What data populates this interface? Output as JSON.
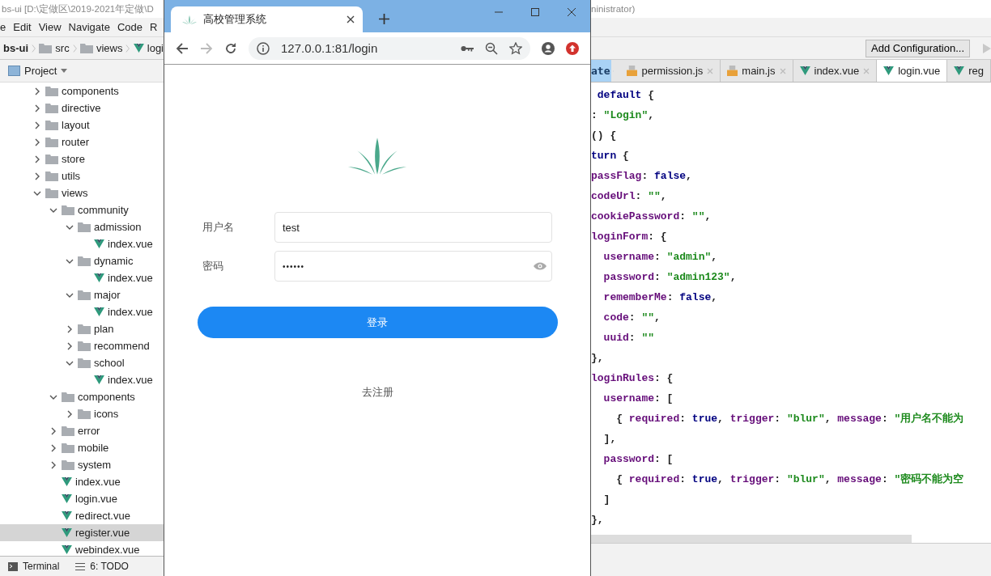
{
  "ide": {
    "title": "bs-ui [D:\\定做区\\2019-2021年定做\\D",
    "title_right": "ninistrator)",
    "menu": [
      "e",
      "Edit",
      "View",
      "Navigate",
      "Code",
      "R"
    ],
    "breadcrumb": [
      "bs-ui",
      "src",
      "views",
      "logi"
    ],
    "project_label": "Project",
    "tree": [
      {
        "label": "components",
        "kind": "folder",
        "expanded": false,
        "selected": false
      },
      {
        "label": "directive",
        "kind": "folder",
        "expanded": false,
        "selected": false
      },
      {
        "label": "layout",
        "kind": "folder",
        "expanded": false,
        "selected": false
      },
      {
        "label": "router",
        "kind": "folder",
        "expanded": false,
        "selected": false
      },
      {
        "label": "store",
        "kind": "folder",
        "expanded": false,
        "selected": false
      },
      {
        "label": "utils",
        "kind": "folder",
        "expanded": false,
        "selected": false
      },
      {
        "label": "views",
        "kind": "folder",
        "expanded": true,
        "selected": false,
        "children": [
          {
            "label": "community",
            "kind": "folder",
            "expanded": true,
            "selected": false,
            "children": [
              {
                "label": "admission",
                "kind": "folder",
                "expanded": true,
                "selected": false,
                "children": [
                  {
                    "label": "index.vue",
                    "kind": "vue",
                    "selected": false
                  }
                ]
              },
              {
                "label": "dynamic",
                "kind": "folder",
                "expanded": true,
                "selected": false,
                "children": [
                  {
                    "label": "index.vue",
                    "kind": "vue",
                    "selected": false
                  }
                ]
              },
              {
                "label": "major",
                "kind": "folder",
                "expanded": true,
                "selected": false,
                "children": [
                  {
                    "label": "index.vue",
                    "kind": "vue",
                    "selected": false
                  }
                ]
              },
              {
                "label": "plan",
                "kind": "folder",
                "expanded": false,
                "selected": false
              },
              {
                "label": "recommend",
                "kind": "folder",
                "expanded": false,
                "selected": false
              },
              {
                "label": "school",
                "kind": "folder",
                "expanded": true,
                "selected": false,
                "children": [
                  {
                    "label": "index.vue",
                    "kind": "vue",
                    "selected": false
                  }
                ]
              }
            ]
          },
          {
            "label": "components",
            "kind": "folder",
            "expanded": true,
            "selected": false,
            "children": [
              {
                "label": "icons",
                "kind": "folder",
                "expanded": false,
                "selected": false
              }
            ]
          },
          {
            "label": "error",
            "kind": "folder",
            "expanded": false,
            "selected": false
          },
          {
            "label": "mobile",
            "kind": "folder",
            "expanded": false,
            "selected": false
          },
          {
            "label": "system",
            "kind": "folder",
            "expanded": false,
            "selected": false
          },
          {
            "label": "index.vue",
            "kind": "vue",
            "selected": false
          },
          {
            "label": "login.vue",
            "kind": "vue",
            "selected": false
          },
          {
            "label": "redirect.vue",
            "kind": "vue",
            "selected": false
          },
          {
            "label": "register.vue",
            "kind": "vue",
            "selected": true
          },
          {
            "label": "webindex.vue",
            "kind": "vue",
            "selected": false
          }
        ]
      }
    ],
    "bottom_tabs": [
      {
        "label": "Terminal",
        "kind": "terminal"
      },
      {
        "label": "6: TODO",
        "kind": "todo"
      }
    ]
  },
  "editor": {
    "run_config": "Add Configuration...",
    "crumb": "ate",
    "tabs": [
      {
        "label": "permission.js",
        "kind": "js",
        "selected": false
      },
      {
        "label": "main.js",
        "kind": "js",
        "selected": false
      },
      {
        "label": "index.vue",
        "kind": "vue",
        "selected": false
      },
      {
        "label": "login.vue",
        "kind": "vue",
        "selected": true
      },
      {
        "label": "reg",
        "kind": "vue",
        "selected": false
      }
    ],
    "lines": [
      [
        {
          "kind": "keyword",
          "text": " default"
        },
        {
          "kind": "plain",
          "text": " {"
        }
      ],
      [
        {
          "kind": "plain",
          "text": ": "
        },
        {
          "kind": "string",
          "text": "\"Login\""
        },
        {
          "kind": "plain",
          "text": ","
        }
      ],
      [
        {
          "kind": "plain",
          "text": "() {"
        }
      ],
      [
        {
          "kind": "keyword",
          "text": "turn"
        },
        {
          "kind": "plain",
          "text": " {"
        }
      ],
      [
        {
          "kind": "property",
          "text": "passFlag"
        },
        {
          "kind": "plain",
          "text": ": "
        },
        {
          "kind": "keyword",
          "text": "false"
        },
        {
          "kind": "plain",
          "text": ","
        }
      ],
      [
        {
          "kind": "property",
          "text": "codeUrl"
        },
        {
          "kind": "plain",
          "text": ": "
        },
        {
          "kind": "string",
          "text": "\"\""
        },
        {
          "kind": "plain",
          "text": ","
        }
      ],
      [
        {
          "kind": "property",
          "text": "cookiePassword"
        },
        {
          "kind": "plain",
          "text": ": "
        },
        {
          "kind": "string",
          "text": "\"\""
        },
        {
          "kind": "plain",
          "text": ","
        }
      ],
      [
        {
          "kind": "property",
          "text": "loginForm"
        },
        {
          "kind": "plain",
          "text": ": {"
        }
      ],
      [
        {
          "kind": "property",
          "text": "  username"
        },
        {
          "kind": "plain",
          "text": ": "
        },
        {
          "kind": "string",
          "text": "\"admin\""
        },
        {
          "kind": "plain",
          "text": ","
        }
      ],
      [
        {
          "kind": "property",
          "text": "  password"
        },
        {
          "kind": "plain",
          "text": ": "
        },
        {
          "kind": "string",
          "text": "\"admin123\""
        },
        {
          "kind": "plain",
          "text": ","
        }
      ],
      [
        {
          "kind": "property",
          "text": "  rememberMe"
        },
        {
          "kind": "plain",
          "text": ": "
        },
        {
          "kind": "keyword",
          "text": "false"
        },
        {
          "kind": "plain",
          "text": ","
        }
      ],
      [
        {
          "kind": "property",
          "text": "  code"
        },
        {
          "kind": "plain",
          "text": ": "
        },
        {
          "kind": "string",
          "text": "\"\""
        },
        {
          "kind": "plain",
          "text": ","
        }
      ],
      [
        {
          "kind": "property",
          "text": "  uuid"
        },
        {
          "kind": "plain",
          "text": ": "
        },
        {
          "kind": "string",
          "text": "\"\""
        }
      ],
      [
        {
          "kind": "plain",
          "text": "},"
        }
      ],
      [
        {
          "kind": "property",
          "text": "loginRules"
        },
        {
          "kind": "plain",
          "text": ": {"
        }
      ],
      [
        {
          "kind": "property",
          "text": "  username"
        },
        {
          "kind": "plain",
          "text": ": ["
        }
      ],
      [
        {
          "kind": "plain",
          "text": "    { "
        },
        {
          "kind": "property",
          "text": "required"
        },
        {
          "kind": "plain",
          "text": ": "
        },
        {
          "kind": "keyword",
          "text": "true"
        },
        {
          "kind": "plain",
          "text": ", "
        },
        {
          "kind": "property",
          "text": "trigger"
        },
        {
          "kind": "plain",
          "text": ": "
        },
        {
          "kind": "string",
          "text": "\"blur\""
        },
        {
          "kind": "plain",
          "text": ", "
        },
        {
          "kind": "property",
          "text": "message"
        },
        {
          "kind": "plain",
          "text": ": "
        },
        {
          "kind": "string",
          "text": "\"用户名不能为"
        }
      ],
      [
        {
          "kind": "plain",
          "text": "  ],"
        }
      ],
      [
        {
          "kind": "property",
          "text": "  password"
        },
        {
          "kind": "plain",
          "text": ": ["
        }
      ],
      [
        {
          "kind": "plain",
          "text": "    { "
        },
        {
          "kind": "property",
          "text": "required"
        },
        {
          "kind": "plain",
          "text": ": "
        },
        {
          "kind": "keyword",
          "text": "true"
        },
        {
          "kind": "plain",
          "text": ", "
        },
        {
          "kind": "property",
          "text": "trigger"
        },
        {
          "kind": "plain",
          "text": ": "
        },
        {
          "kind": "string",
          "text": "\"blur\""
        },
        {
          "kind": "plain",
          "text": ", "
        },
        {
          "kind": "property",
          "text": "message"
        },
        {
          "kind": "plain",
          "text": ": "
        },
        {
          "kind": "string",
          "text": "\"密码不能为空"
        }
      ],
      [
        {
          "kind": "plain",
          "text": "  ]"
        }
      ],
      [
        {
          "kind": "plain",
          "text": "},"
        }
      ]
    ]
  },
  "browser": {
    "tab_title": "高校管理系统",
    "url": "127.0.0.1:81/login",
    "forward_disabled": true,
    "page": {
      "username_label": "用户名",
      "username_value": "test",
      "password_label": "密码",
      "password_value": "••••••",
      "submit": "登录",
      "register_link": "去注册"
    }
  }
}
